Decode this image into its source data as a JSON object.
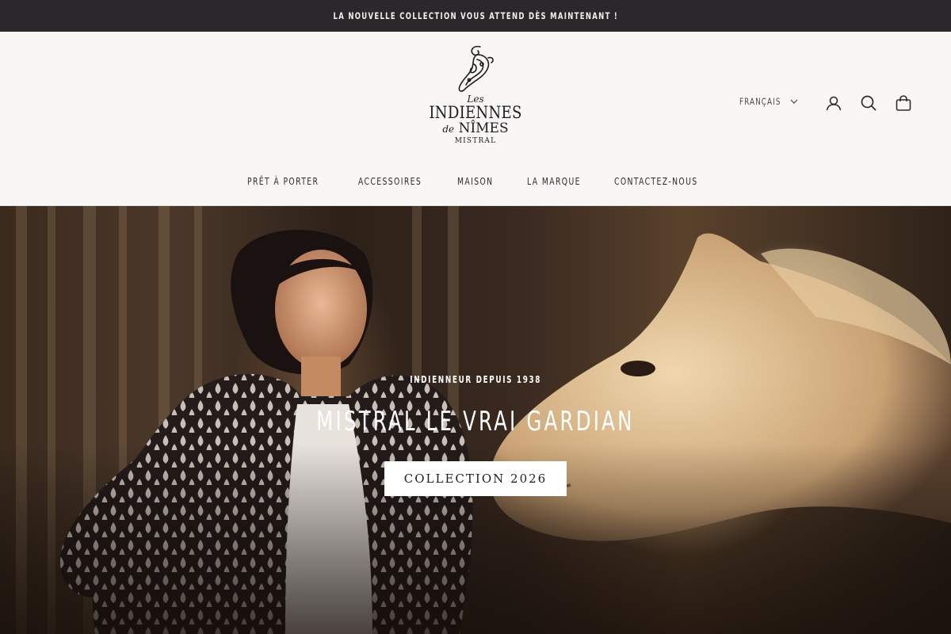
{
  "announcement": {
    "text": "LA NOUVELLE COLLECTION VOUS ATTEND DÈS MAINTENANT !"
  },
  "brand": {
    "les": "Les",
    "indiennes": "INDIENNES",
    "de": "de",
    "nimes": "NÎMES",
    "mistral": "MISTRAL"
  },
  "header": {
    "language": "FRANÇAIS",
    "icons": [
      "account-icon",
      "search-icon",
      "cart-icon"
    ]
  },
  "nav": {
    "items": [
      {
        "label": "PRÊT À PORTER"
      },
      {
        "label": "ACCESSOIRES"
      },
      {
        "label": "MAISON"
      },
      {
        "label": "LA MARQUE"
      },
      {
        "label": "CONTACTEZ-NOUS"
      }
    ]
  },
  "hero": {
    "eyebrow": "INDIENNEUR DEPUIS 1938",
    "headline": "MISTRAL LE VRAI GARDIAN",
    "cta_label": "COLLECTION 2026"
  },
  "colors": {
    "announcement_bg": "#2a282b",
    "header_bg": "#f8f7f6",
    "text": "#2a2a2a",
    "cta_bg": "#ffffff"
  }
}
